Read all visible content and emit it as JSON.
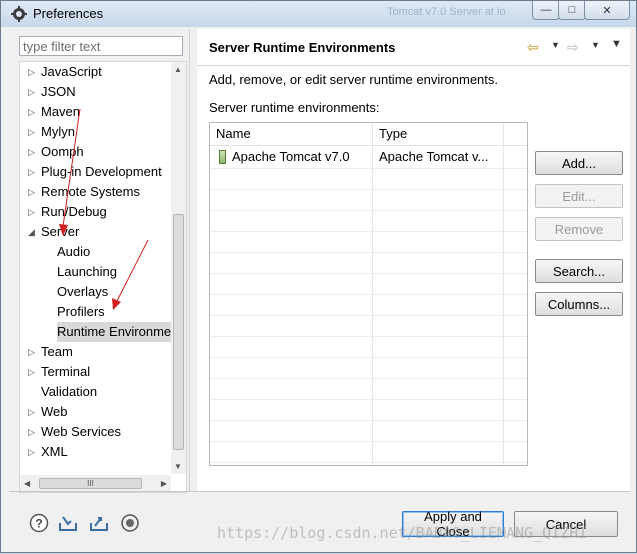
{
  "window": {
    "title": "Preferences",
    "ghost_tabs": [
      "Tomcat v7.0 Server at lo"
    ],
    "controls": {
      "minimize": "—",
      "maximize": "□",
      "close": "✕"
    }
  },
  "filter": {
    "placeholder": "type filter text"
  },
  "tree": {
    "items": [
      {
        "label": "JavaScript",
        "twistie": "▷",
        "level": 0
      },
      {
        "label": "JSON",
        "twistie": "▷",
        "level": 0
      },
      {
        "label": "Maven",
        "twistie": "▷",
        "level": 0
      },
      {
        "label": "Mylyn",
        "twistie": "▷",
        "level": 0
      },
      {
        "label": "Oomph",
        "twistie": "▷",
        "level": 0
      },
      {
        "label": "Plug-in Development",
        "twistie": "▷",
        "level": 0
      },
      {
        "label": "Remote Systems",
        "twistie": "▷",
        "level": 0
      },
      {
        "label": "Run/Debug",
        "twistie": "▷",
        "level": 0
      },
      {
        "label": "Server",
        "twistie": "◢",
        "level": 0
      },
      {
        "label": "Audio",
        "twistie": "",
        "level": 1
      },
      {
        "label": "Launching",
        "twistie": "",
        "level": 1
      },
      {
        "label": "Overlays",
        "twistie": "",
        "level": 1
      },
      {
        "label": "Profilers",
        "twistie": "",
        "level": 1
      },
      {
        "label": "Runtime Environments",
        "twistie": "",
        "level": 1,
        "selected": true
      },
      {
        "label": "Team",
        "twistie": "▷",
        "level": 0
      },
      {
        "label": "Terminal",
        "twistie": "▷",
        "level": 0
      },
      {
        "label": "Validation",
        "twistie": "",
        "level": 0
      },
      {
        "label": "Web",
        "twistie": "▷",
        "level": 0
      },
      {
        "label": "Web Services",
        "twistie": "▷",
        "level": 0
      },
      {
        "label": "XML",
        "twistie": "▷",
        "level": 0
      }
    ],
    "hscroll_grip": "III"
  },
  "page": {
    "title": "Server Runtime Environments",
    "description": "Add, remove, or edit server runtime environments.",
    "list_label": "Server runtime environments:",
    "columns": [
      "Name",
      "Type"
    ],
    "rows": [
      {
        "name": "Apache Tomcat v7.0",
        "type": "Apache Tomcat v..."
      }
    ],
    "buttons": {
      "add": "Add...",
      "edit": "Edit...",
      "remove": "Remove",
      "search": "Search...",
      "columns": "Columns..."
    }
  },
  "footer": {
    "apply_close": "Apply and Close",
    "cancel": "Cancel"
  },
  "watermark": "https://blog.csdn.net/BABAO_LIEMANG_QIZHI",
  "colors": {
    "accent": "#2e7bcf",
    "arrow": "#d42020",
    "nav_arrow": "#c8911c"
  }
}
